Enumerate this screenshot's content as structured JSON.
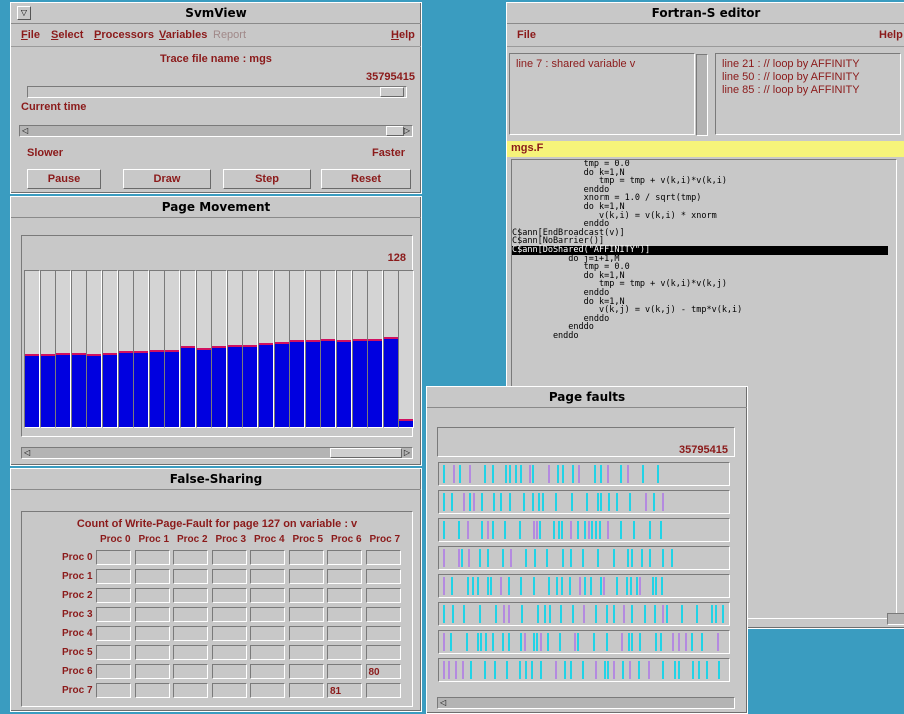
{
  "svmview": {
    "title": "SvmView",
    "menu": [
      "File",
      "Select",
      "Processors",
      "Variables",
      "Report"
    ],
    "help": "Help",
    "trace_label": "Trace file name : mgs",
    "time_value": "35795415",
    "current_time_label": "Current time",
    "slower_label": "Slower",
    "faster_label": "Faster",
    "buttons": [
      "Pause",
      "Draw",
      "Step",
      "Reset"
    ]
  },
  "page_movement": {
    "title": "Page Movement",
    "max_value": "128",
    "bar_fill_fractions": [
      0.46,
      0.46,
      0.47,
      0.47,
      0.46,
      0.47,
      0.48,
      0.48,
      0.49,
      0.49,
      0.51,
      0.5,
      0.51,
      0.52,
      0.52,
      0.53,
      0.54,
      0.55,
      0.55,
      0.56,
      0.55,
      0.56,
      0.56,
      0.57,
      0.04
    ],
    "bar_color": "#0000e0"
  },
  "false_sharing": {
    "title": "False-Sharing",
    "caption": "Count of Write-Page-Fault for page 127 on variable : v",
    "col_headers": [
      "Proc 0",
      "Proc 1",
      "Proc 2",
      "Proc 3",
      "Proc 4",
      "Proc 5",
      "Proc 6",
      "Proc 7"
    ],
    "row_headers": [
      "Proc 0",
      "Proc 1",
      "Proc 2",
      "Proc 3",
      "Proc 4",
      "Proc 5",
      "Proc 6",
      "Proc 7"
    ],
    "cells": [
      [
        "",
        "",
        "",
        "",
        "",
        "",
        "",
        ""
      ],
      [
        "",
        "",
        "",
        "",
        "",
        "",
        "",
        ""
      ],
      [
        "",
        "",
        "",
        "",
        "",
        "",
        "",
        ""
      ],
      [
        "",
        "",
        "",
        "",
        "",
        "",
        "",
        ""
      ],
      [
        "",
        "",
        "",
        "",
        "",
        "",
        "",
        ""
      ],
      [
        "",
        "",
        "",
        "",
        "",
        "",
        "",
        ""
      ],
      [
        "",
        "",
        "",
        "",
        "",
        "",
        "",
        "80"
      ],
      [
        "",
        "",
        "",
        "",
        "",
        "",
        "81",
        ""
      ]
    ]
  },
  "editor": {
    "title": "Fortran-S editor",
    "menu_file": "File",
    "help": "Help",
    "left_list": [
      "line  7 : shared variable v"
    ],
    "right_list": [
      "line  21 : // loop by AFFINITY",
      "line  50 : // loop by AFFINITY",
      "line  85 : // loop by AFFINITY"
    ],
    "filename": "mgs.F",
    "code_lines": [
      "              tmp = 0.0",
      "              do k=1,N",
      "                 tmp = tmp + v(k,i)*v(k,i)",
      "              enddo",
      "              xnorm = 1.0 / sqrt(tmp)",
      "              do k=1,N",
      "                 v(k,i) = v(k,i) * xnorm",
      "              enddo",
      "C$ann[EndBroadcast(v)]",
      "C$ann[NoBarrier()]",
      "C$ann[DoShared(\"AFFINITY\")]",
      "           do j=i+1,M",
      "              tmp = 0.0",
      "              do k=1,N",
      "                 tmp = tmp + v(k,i)*v(k,j)",
      "              enddo",
      "              do k=1,N",
      "                 v(k,j) = v(k,j) - tmp*v(k,i)",
      "              enddo",
      "           enddo",
      "        enddo"
    ],
    "highlighted_line": 10
  },
  "page_faults": {
    "title": "Page faults",
    "value": "35795415",
    "trace_color": "#22d3e6",
    "trace_color_alt": "#b48ae0"
  }
}
